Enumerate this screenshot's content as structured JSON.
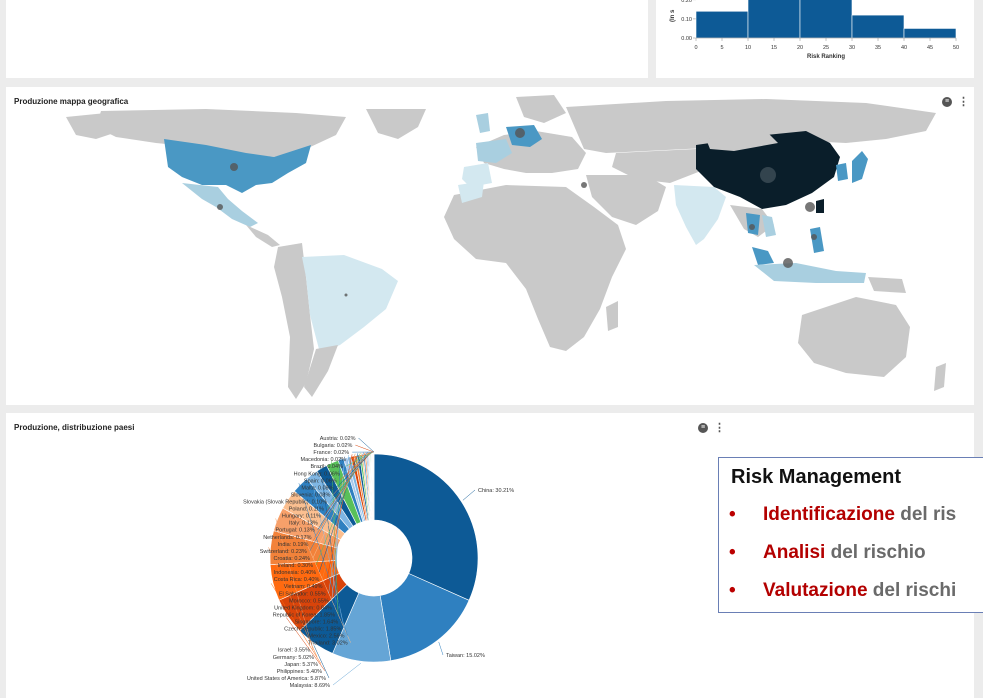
{
  "histogram": {
    "y_axis_label": "(ln s",
    "y_ticks": [
      "0.20",
      "0.10",
      "0.00"
    ],
    "x_ticks": [
      "0",
      "5",
      "10",
      "15",
      "20",
      "25",
      "30",
      "35",
      "40",
      "45",
      "50"
    ],
    "x_label": "Risk Ranking",
    "bar_color": "#0d5a96"
  },
  "map": {
    "title": "Produzione mappa geografica",
    "colors": {
      "land": "#c9c9c9",
      "high": "#0a1e2a",
      "mid": "#4a98c4",
      "low": "#d3e8f0",
      "marker": "#555555"
    }
  },
  "pie": {
    "title": "Produzione, distribuzione paesi"
  },
  "risk_box": {
    "title": "Risk Management",
    "items": [
      {
        "bullet": "•",
        "keyword": "Identificazione",
        "rest": " del ris"
      },
      {
        "bullet": "•",
        "keyword": "Analisi",
        "rest": " del rischio"
      },
      {
        "bullet": "•",
        "keyword": "Valutazione",
        "rest": " del rischi"
      }
    ]
  },
  "icons": {
    "filter": "filter-icon",
    "menu": "kebab-menu-icon"
  },
  "chart_data": [
    {
      "type": "bar",
      "title": "",
      "xlabel": "Risk Ranking",
      "ylabel": "",
      "x_bins": [
        [
          0,
          10
        ],
        [
          10,
          20
        ],
        [
          20,
          30
        ],
        [
          30,
          40
        ],
        [
          40,
          50
        ]
      ],
      "values": [
        0.14,
        0.24,
        0.24,
        0.12,
        0.05
      ],
      "ylim": [
        0,
        0.22
      ],
      "xlim": [
        0,
        50
      ]
    },
    {
      "type": "pie",
      "title": "Produzione, distribuzione paesi",
      "donut": true,
      "categories": [
        "China",
        "Taiwan",
        "Malaysia",
        "United States of America",
        "Philippines",
        "Japan",
        "Germany",
        "Israel",
        "Thailand",
        "Mexico",
        "Czech Republic",
        "Singapore",
        "Republic of Korea",
        "United Kingdom",
        "Morocco",
        "El Salvador",
        "Vietnam",
        "Costa Rica",
        "Indonesia",
        "Ireland",
        "Croatia",
        "Switzerland",
        "India",
        "Netherlands",
        "Portugal",
        "Italy",
        "Hungary",
        "Poland",
        "Slovakia (Slovak Republic)",
        "Slovenia",
        "Malta",
        "Spain",
        "Hong Kong",
        "Brazil",
        "Macedonia",
        "France",
        "Bulgaria",
        "Austria"
      ],
      "labels": [
        "China: 30.21%",
        "Taiwan: 15.02%",
        "Malaysia: 8.69%",
        "United States of America: 5.87%",
        "Philippines: 5.40%",
        "Japan: 5.37%",
        "Germany: 5.02%",
        "Israel: 3.55%",
        "Thailand: 3.02%",
        "Mexico: 2.56%",
        "Czech Republic: 1.85%",
        "Singapore: 1.64%",
        "Republic of Korea: 1.85%",
        "United Kingdom: 0.84%",
        "Morocco: 0.55%",
        "El Salvador: 0.55%",
        "Vietnam: 0.49%",
        "Costa Rica: 0.40%",
        "Indonesia: 0.40%",
        "Ireland: 0.30%",
        "Croatia: 0.24%",
        "Switzerland: 0.23%",
        "India: 0.19%",
        "Netherlands: 0.17%",
        "Portugal: 0.13%",
        "Italy: 0.13%",
        "Hungary: 0.11%",
        "Poland: 0.11%",
        "Slovakia (Slovak Republic): 0.10%",
        "Slovenia: 0.08%",
        "Malta: 0.08%",
        "Spain: 0.06%",
        "Hong Kong: 0.06%",
        "Brazil: 0.04%",
        "Macedonia: 0.02%",
        "France: 0.02%",
        "Bulgaria: 0.02%",
        "Austria: 0.02%"
      ],
      "values": [
        30.21,
        15.02,
        8.69,
        5.87,
        5.4,
        5.37,
        5.02,
        3.55,
        3.02,
        2.56,
        1.85,
        1.64,
        1.85,
        0.84,
        0.55,
        0.55,
        0.49,
        0.4,
        0.4,
        0.3,
        0.24,
        0.23,
        0.19,
        0.17,
        0.13,
        0.13,
        0.11,
        0.11,
        0.1,
        0.08,
        0.08,
        0.06,
        0.06,
        0.04,
        0.02,
        0.02,
        0.02,
        0.02
      ],
      "colors": [
        "#0d5a96",
        "#2f80c0",
        "#65a5d6",
        "#0d5a96",
        "#d9440a",
        "#ff6a10",
        "#f2823a",
        "#f7a06a",
        "#fbbf90",
        "#2f80c0",
        "#7fb6e3",
        "#0d5a96",
        "#59c05a",
        "#2f80c0",
        "#a9c9ec",
        "#7fb6e3",
        "#d9440a",
        "#f2823a",
        "#0d5a96",
        "#59c05a",
        "#fbbf90",
        "#2f80c0",
        "#ff6a10",
        "#65a5d6",
        "#0d5a96",
        "#a9c9ec",
        "#d9440a",
        "#59c05a",
        "#2f80c0",
        "#f7a06a",
        "#0d5a96",
        "#ff6a10",
        "#65a5d6",
        "#59c05a",
        "#f2823a",
        "#2f80c0",
        "#d9440a",
        "#0d5a96"
      ]
    }
  ]
}
